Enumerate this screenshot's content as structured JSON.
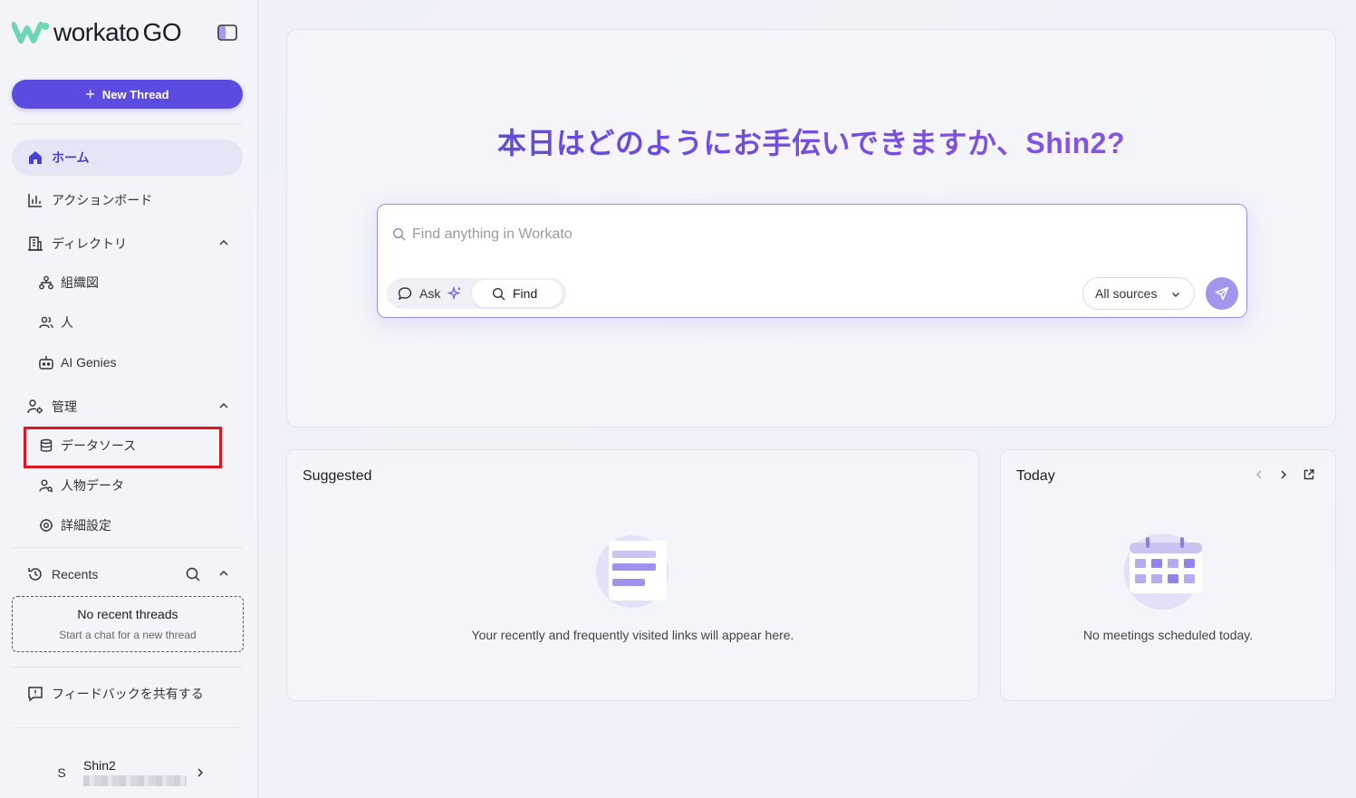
{
  "brand": {
    "name_part1": "workato",
    "name_part2": "GO"
  },
  "sidebar": {
    "new_thread_label": "New Thread",
    "items": {
      "home": "ホーム",
      "action_board": "アクションボード",
      "directory": "ディレクトリ",
      "org_chart": "組織図",
      "people": "人",
      "ai_genies": "AI Genies",
      "admin": "管理",
      "data_sources": "データソース",
      "person_data": "人物データ",
      "advanced_settings": "詳細設定",
      "recents": "Recents",
      "feedback": "フィードバックを共有する"
    },
    "recents_empty": {
      "title": "No recent threads",
      "subtitle": "Start a chat for a new thread"
    },
    "user": {
      "avatar_initial": "S",
      "name": "Shin2"
    }
  },
  "main": {
    "greeting": "本日はどのようにお手伝いできますか、Shin2?",
    "search": {
      "placeholder": "Find anything in Workato",
      "mode_ask": "Ask",
      "mode_find": "Find",
      "sources_label": "All sources"
    },
    "suggested": {
      "title": "Suggested",
      "empty_text": "Your recently and frequently visited links will appear here."
    },
    "today": {
      "title": "Today",
      "empty_text": "No meetings scheduled today."
    }
  },
  "colors": {
    "accent": "#5b4be0",
    "highlight_box": "#e0141e",
    "logo_green": "#6fd6b4",
    "send_button": "#a196ee"
  }
}
